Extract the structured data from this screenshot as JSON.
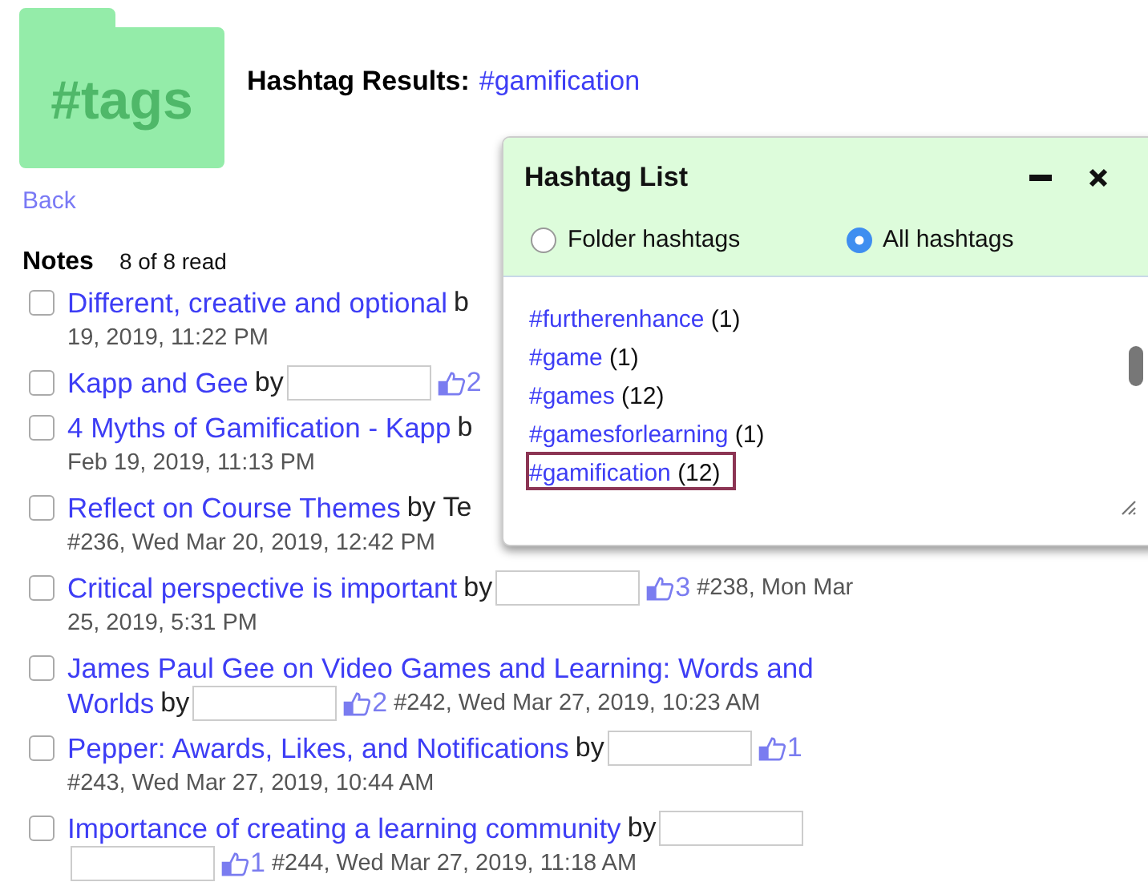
{
  "folder": {
    "label": "#tags"
  },
  "heading": {
    "label": "Hashtag Results:",
    "tag": "#gamification"
  },
  "back": "Back",
  "notes_header": {
    "title": "Notes",
    "count": "8 of 8 read"
  },
  "notes": [
    {
      "checked": false,
      "lines": [
        [
          {
            "kind": "title",
            "text": "Different, creative and optional"
          },
          {
            "kind": "by",
            "text": "b"
          }
        ],
        [
          {
            "kind": "meta",
            "text": "19, 2019, 11:22 PM"
          }
        ]
      ]
    },
    {
      "checked": false,
      "lines": [
        [
          {
            "kind": "title",
            "text": "Kapp and Gee"
          },
          {
            "kind": "by",
            "text": "by"
          },
          {
            "kind": "blank"
          },
          {
            "kind": "likes",
            "text": "2"
          }
        ]
      ]
    },
    {
      "checked": false,
      "lines": [
        [
          {
            "kind": "title",
            "text": "4 Myths of Gamification - Kapp"
          },
          {
            "kind": "by",
            "text": "b"
          }
        ],
        [
          {
            "kind": "meta",
            "text": "Feb 19, 2019, 11:13 PM"
          }
        ]
      ]
    },
    {
      "checked": false,
      "lines": [
        [
          {
            "kind": "title",
            "text": "Reflect on Course Themes"
          },
          {
            "kind": "by",
            "text": "by Te"
          }
        ],
        [
          {
            "kind": "meta",
            "text": "#236, Wed Mar 20, 2019, 12:42 PM"
          }
        ]
      ]
    },
    {
      "checked": false,
      "lines": [
        [
          {
            "kind": "title",
            "text": "Critical perspective is important"
          },
          {
            "kind": "by",
            "text": "by"
          },
          {
            "kind": "blank"
          },
          {
            "kind": "likes",
            "text": "3"
          },
          {
            "kind": "meta",
            "text": "#238, Mon Mar"
          }
        ],
        [
          {
            "kind": "meta",
            "text": "25, 2019, 5:31 PM"
          }
        ]
      ]
    },
    {
      "checked": false,
      "lines": [
        [
          {
            "kind": "title",
            "text": "James Paul Gee on Video Games and Learning: Words and"
          }
        ],
        [
          {
            "kind": "title",
            "text": "Worlds"
          },
          {
            "kind": "by",
            "text": "by"
          },
          {
            "kind": "blank"
          },
          {
            "kind": "likes",
            "text": "2"
          },
          {
            "kind": "meta",
            "text": "#242, Wed Mar 27, 2019, 10:23 AM"
          }
        ]
      ]
    },
    {
      "checked": false,
      "lines": [
        [
          {
            "kind": "title",
            "text": "Pepper: Awards, Likes, and Notifications"
          },
          {
            "kind": "by",
            "text": "by"
          },
          {
            "kind": "blank"
          },
          {
            "kind": "likes",
            "text": "1"
          }
        ],
        [
          {
            "kind": "meta",
            "text": "#243, Wed Mar 27, 2019, 10:44 AM"
          }
        ]
      ]
    },
    {
      "checked": false,
      "lines": [
        [
          {
            "kind": "title",
            "text": "Importance of creating a learning community"
          },
          {
            "kind": "by",
            "text": "by"
          },
          {
            "kind": "blank"
          }
        ],
        [
          {
            "kind": "blank"
          },
          {
            "kind": "likes",
            "text": "1"
          },
          {
            "kind": "meta",
            "text": "#244, Wed Mar 27, 2019, 11:18 AM"
          }
        ]
      ]
    }
  ],
  "hashtag_panel": {
    "title": "Hashtag List",
    "options": [
      {
        "label": "Folder hashtags",
        "selected": false
      },
      {
        "label": "All hashtags",
        "selected": true
      }
    ],
    "tags": [
      {
        "tag": "#furtherenhance",
        "count": "(1)",
        "selected": false
      },
      {
        "tag": "#game",
        "count": "(1)",
        "selected": false
      },
      {
        "tag": "#games",
        "count": "(12)",
        "selected": false
      },
      {
        "tag": "#gamesforlearning",
        "count": "(1)",
        "selected": false
      },
      {
        "tag": "#gamification",
        "count": "(12)",
        "selected": true
      }
    ]
  }
}
